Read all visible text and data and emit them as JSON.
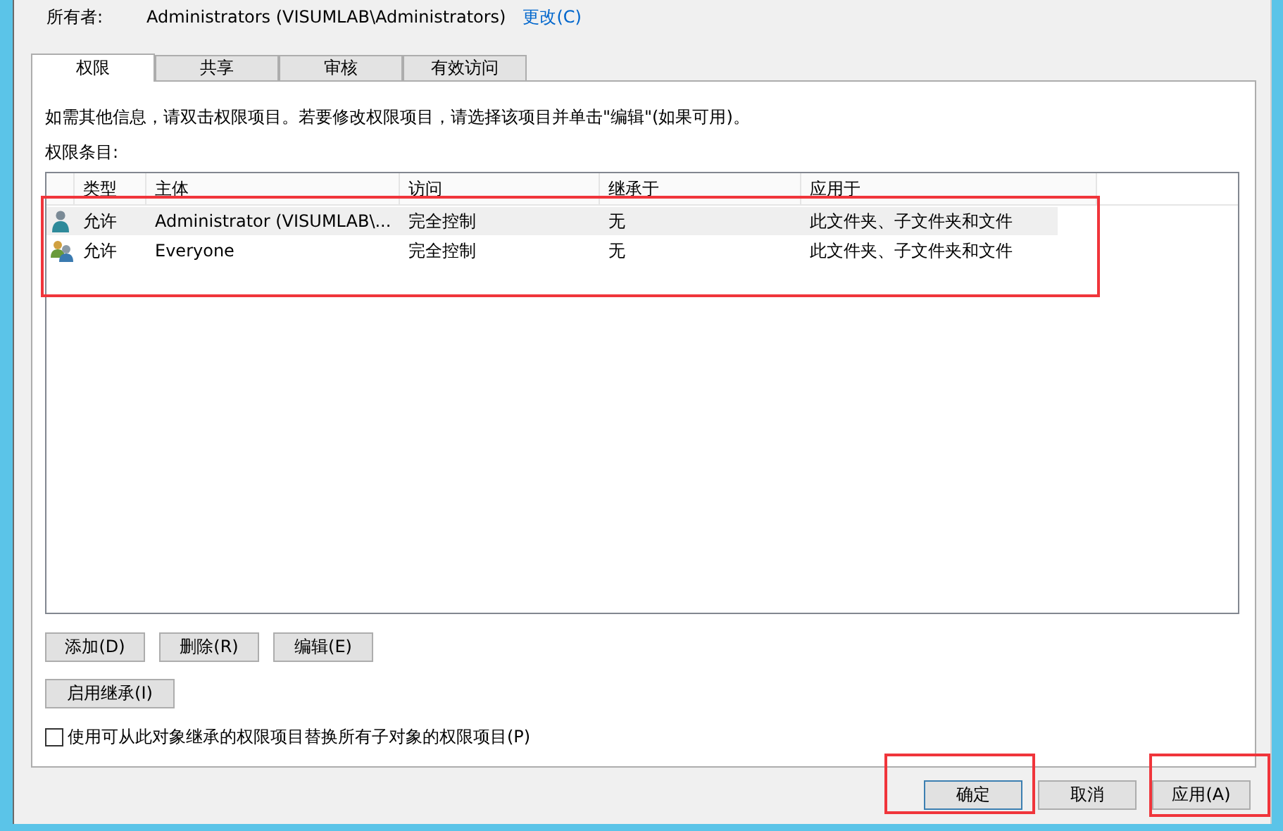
{
  "owner": {
    "label": "所有者:",
    "value": "Administrators (VISUMLAB\\Administrators)",
    "link": "更改(C)"
  },
  "tabs": [
    {
      "label": "权限",
      "selected": true
    },
    {
      "label": "共享",
      "selected": false
    },
    {
      "label": "审核",
      "selected": false
    },
    {
      "label": "有效访问",
      "selected": false
    }
  ],
  "info": "如需其他信息，请双击权限项目。若要修改权限项目，请选择该项目并单击\"编辑\"(如果可用)。",
  "entries_label": "权限条目:",
  "table": {
    "columns": [
      "类型",
      "主体",
      "访问",
      "继承于",
      "应用于"
    ],
    "rows": [
      {
        "kind": "user",
        "type": "允许",
        "principal": "Administrator (VISUMLAB\\...",
        "access": "完全控制",
        "inherited_from": "无",
        "applies_to": "此文件夹、子文件夹和文件",
        "selected": true
      },
      {
        "kind": "group",
        "type": "允许",
        "principal": "Everyone",
        "access": "完全控制",
        "inherited_from": "无",
        "applies_to": "此文件夹、子文件夹和文件",
        "selected": false
      }
    ]
  },
  "list_buttons": [
    "添加(D)",
    "删除(R)",
    "编辑(E)"
  ],
  "inherit_button": "启用继承(I)",
  "replace_checkbox": {
    "label": "使用可从此对象继承的权限项目替换所有子对象的权限项目(P)",
    "checked": false
  },
  "dialog_buttons": [
    {
      "label": "确定",
      "default": true
    },
    {
      "label": "取消",
      "default": false
    },
    {
      "label": "应用(A)",
      "default": false
    }
  ]
}
